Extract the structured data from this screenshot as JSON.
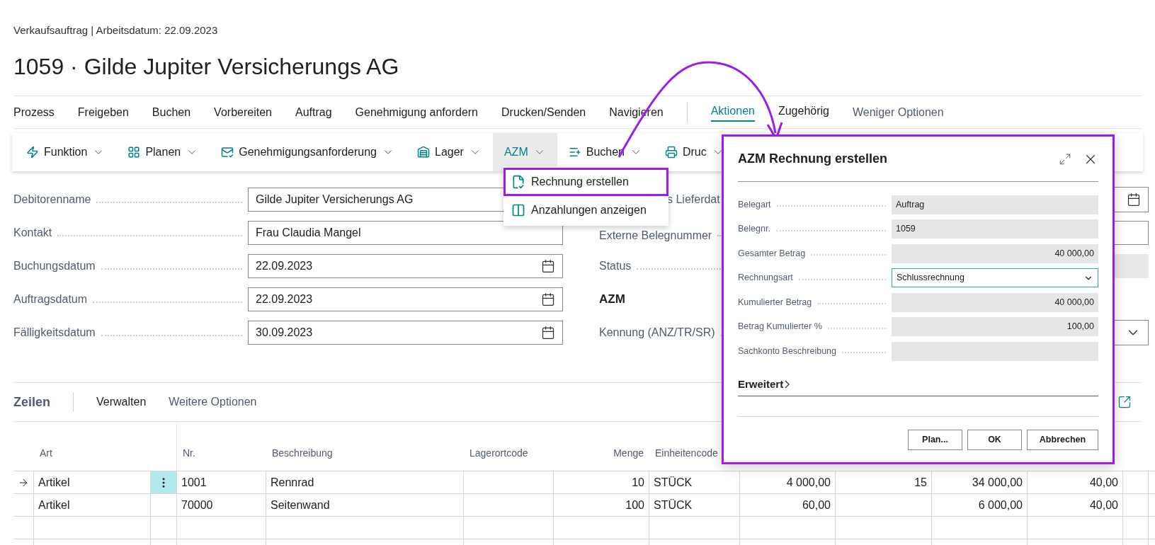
{
  "breadcrumb": "Verkaufsauftrag | Arbeitsdatum: 22.09.2023",
  "title": "1059 · Gilde Jupiter Versicherungs AG",
  "action_bar": {
    "menus": [
      "Prozess",
      "Freigeben",
      "Buchen",
      "Vorbereiten",
      "Auftrag",
      "Genehmigung anfordern",
      "Drucken/Senden",
      "Navigieren"
    ],
    "tabs": [
      {
        "label": "Aktionen",
        "selected": true
      },
      {
        "label": "Zugehörig",
        "selected": false
      }
    ],
    "more": "Weniger Optionen"
  },
  "toolbar": [
    {
      "label": "Funktion",
      "expanded": false
    },
    {
      "label": "Planen",
      "expanded": false
    },
    {
      "label": "Genehmigungsanforderung",
      "expanded": false
    },
    {
      "label": "Lager",
      "expanded": false
    },
    {
      "label": "AZM",
      "expanded": true
    },
    {
      "label": "Buchen",
      "expanded": false
    },
    {
      "label": "Druc",
      "expanded": false
    }
  ],
  "menu": [
    {
      "label": "Rechnung erstellen",
      "selected": true
    },
    {
      "label": "Anzahlungen anzeigen",
      "selected": false
    }
  ],
  "fields": [
    {
      "label": "Debitorenname",
      "value": "Gilde Jupiter Versicherungs AG",
      "kind": "text"
    },
    {
      "label": "Kontakt",
      "value": "Frau Claudia Mangel",
      "kind": "text"
    },
    {
      "label": "Buchungsdatum",
      "value": "22.09.2023",
      "kind": "date"
    },
    {
      "label": "Auftragsdatum",
      "value": "22.09.2023",
      "kind": "date"
    },
    {
      "label": "Fälligkeitsdatum",
      "value": "30.09.2023",
      "kind": "date"
    }
  ],
  "right_fields": [
    {
      "label": "s Lieferdat",
      "kind": "date"
    },
    {
      "label": "Externe Belegnummer",
      "kind": "text"
    },
    {
      "label": "Status",
      "kind": "readonly"
    },
    {
      "label": "AZM",
      "kind": "heading"
    },
    {
      "label": "Kennung (ANZ/TR/SR)",
      "kind": "select"
    }
  ],
  "lines": {
    "title": "Zeilen",
    "actions": [
      "Verwalten",
      "Weitere Optionen"
    ],
    "columns": [
      "Art",
      "Nr.",
      "Beschreibung",
      "Lagerortcode",
      "Menge",
      "Einheitencode"
    ],
    "rows": [
      {
        "current": true,
        "cells": [
          "Artikel",
          "1001",
          "Rennrad",
          null,
          "10",
          "STÜCK",
          "4 000,00",
          "15",
          "34 000,00",
          "40,00"
        ]
      },
      {
        "current": false,
        "cells": [
          "Artikel",
          "70000",
          "Seitenwand",
          null,
          "100",
          "STÜCK",
          "60,00",
          null,
          "6 000,00",
          "40,00"
        ]
      }
    ]
  },
  "dialog": {
    "title": "AZM Rechnung erstellen",
    "fields": [
      {
        "label": "Belegart",
        "value": "Auftrag",
        "kind": "text"
      },
      {
        "label": "Belegnr.",
        "value": "1059",
        "kind": "text"
      },
      {
        "label": "Gesamter Betrag",
        "value": "40 000,00",
        "kind": "amount"
      },
      {
        "label": "Rechnungsart",
        "value": "Schlussrechnung",
        "kind": "select"
      },
      {
        "label": "Kumulierter Betrag",
        "value": "40 000,00",
        "kind": "amount"
      },
      {
        "label": "Betrag Kumulierter %",
        "value": "100,00",
        "kind": "amount"
      },
      {
        "label": "Sachkonto Beschreibung",
        "kind": "text"
      }
    ],
    "section": "Erweitert",
    "buttons": [
      "Plan...",
      "OK",
      "Abbrechen"
    ]
  }
}
